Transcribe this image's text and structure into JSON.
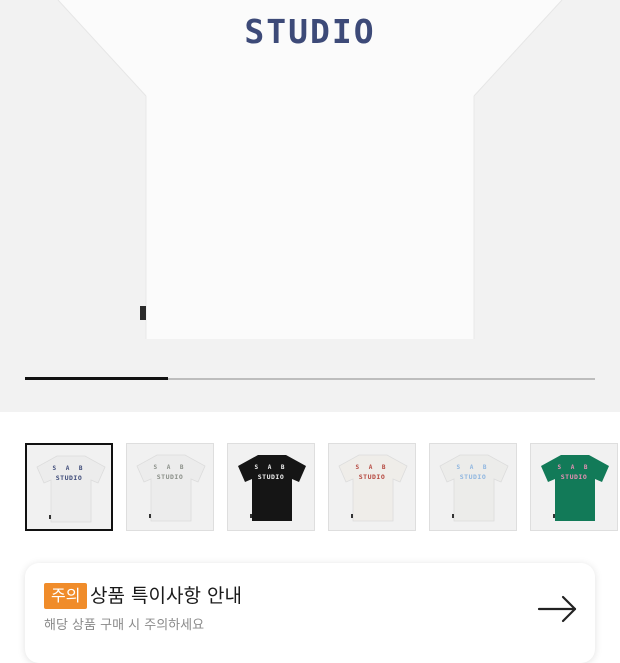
{
  "hero": {
    "print_text": "STUDIO",
    "image_name": "white t-shirt back view",
    "progress": {
      "current": 1,
      "total": 4
    }
  },
  "thumbnails": [
    {
      "name": "white-navy",
      "shirt_color": "#ececec",
      "print_color": "#3d4a78",
      "top_text": "S A B",
      "bottom_text": "STUDIO",
      "selected": true
    },
    {
      "name": "white-grey",
      "shirt_color": "#ececec",
      "print_color": "#8a8f88",
      "top_text": "S A B",
      "bottom_text": "STUDIO",
      "selected": false
    },
    {
      "name": "black",
      "shirt_color": "#151515",
      "print_color": "#f2f2f2",
      "top_text": "S A B",
      "bottom_text": "STUDIO",
      "selected": false
    },
    {
      "name": "white-red",
      "shirt_color": "#efede9",
      "print_color": "#b5473e",
      "top_text": "S A B",
      "bottom_text": "STUDIO",
      "selected": false
    },
    {
      "name": "white-sky",
      "shirt_color": "#ececea",
      "print_color": "#8fb6e0",
      "top_text": "S A B",
      "bottom_text": "STUDIO",
      "selected": false
    },
    {
      "name": "green-pink",
      "shirt_color": "#127a58",
      "print_color": "#e98fb5",
      "top_text": "S A B",
      "bottom_text": "STUDIO",
      "selected": false
    }
  ],
  "notice": {
    "badge": "주의",
    "title": "상품 특이사항 안내",
    "subtitle": "해당 상품 구매 시 주의하세요",
    "arrow_icon": "arrow-right-icon"
  },
  "colors": {
    "accent": "#f08c2a",
    "hero_bg": "#f2f2f2",
    "print_navy": "#3d4a78"
  }
}
